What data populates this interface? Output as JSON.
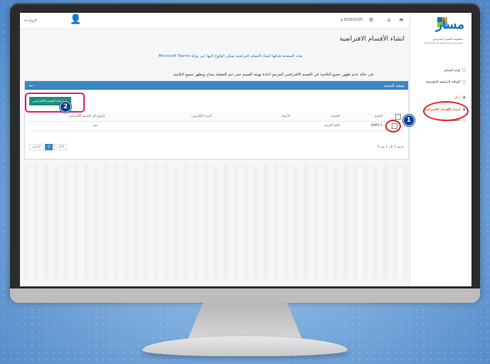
{
  "topbar": {
    "year": "◂ 2019/2020",
    "user": "◂ الرواية"
  },
  "sidebar": {
    "logo_mark": "مسار",
    "logo_sub1": "منظومة التسيير المدرسي",
    "logo_sub2": "SYSTEME DE GESTION SCOLAIRE",
    "items": [
      {
        "label": "لوحة التحكم"
      },
      {
        "label": "الهيكلة الرئيسية للمؤسسة"
      },
      {
        "label": "…ل"
      },
      {
        "label": "انشاء الفضاء الافتراضي"
      },
      {
        "label": "الأقسام"
      }
    ]
  },
  "main": {
    "page_title": "انشاء الأقسام الافتراضية",
    "info_text": "هذه الصفحة هدفها انشاء أقسام افتراضية يمكن الولوج اليها عبر بوابة Microsoft Teams",
    "warn_text": "في حالة عدم ظهور جميع التلاميذ في القسم الافتراضي المرجو اعادة تهيئة القسم حتى تتم العملية بنجاح ويظهر جميع التلاميذ",
    "panel_title": "نتيجة البحث",
    "panel_toggle": "−",
    "create_button": "انشاء القسم الافتراضي",
    "table": {
      "headers": [
        "القسم",
        "الشعبة",
        "الأستاذ",
        "البريد الإلكتروني",
        "الولوج الى القسم الافتراضي"
      ],
      "rows": [
        {
          "code": "RAPG-1",
          "branch": "اللغة العربية",
          "teacher": "",
          "email": "",
          "access": "نعم"
        }
      ]
    },
    "paging": {
      "prev": "السابق",
      "page": "1",
      "next": "التالي"
    },
    "count": "عرض 1 إلى 1 من 1"
  },
  "badges": {
    "one": "1",
    "two": "2"
  }
}
